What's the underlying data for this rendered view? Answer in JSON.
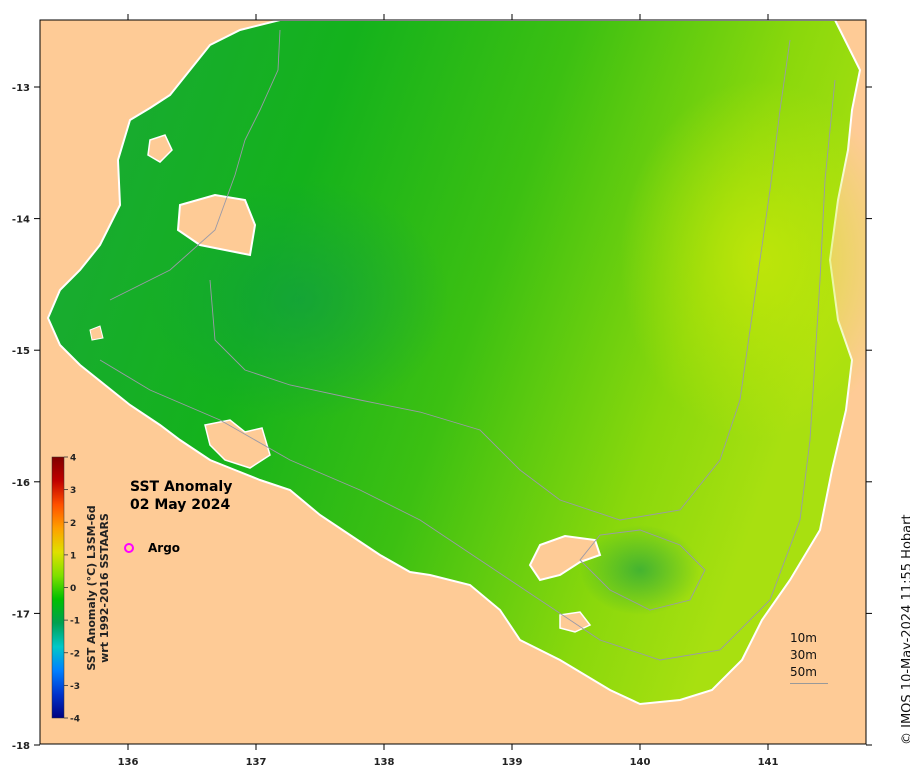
{
  "map": {
    "lon_ticks": [
      "136",
      "137",
      "138",
      "139",
      "140",
      "141"
    ],
    "lat_ticks": [
      "-13",
      "-14",
      "-15",
      "-16",
      "-17",
      "-18"
    ],
    "land_color": "#fecb96",
    "ocean_green": "#1ea81e"
  },
  "title": {
    "line1": "SST Anomaly",
    "line2": "02 May 2024"
  },
  "colorbar": {
    "label_line1": "SST Anomaly (°C) L3SM-6d",
    "label_line2": "wrt 1992-2016 SSTAARS",
    "ticks": [
      "4",
      "3",
      "2",
      "1",
      "0",
      "-1",
      "-2",
      "-3",
      "-4"
    ],
    "colors": [
      "#000080",
      "#0033cc",
      "#0080ff",
      "#00c8c8",
      "#00a050",
      "#00c000",
      "#80e000",
      "#e0e000",
      "#ffa000",
      "#ff5000",
      "#c00000",
      "#800000"
    ]
  },
  "legend": {
    "argo_label": "Argo",
    "argo_color": "#ff00ff"
  },
  "depth_legend": {
    "labels": [
      "10m",
      "30m",
      "50m"
    ]
  },
  "credit": "© IMOS 10-May-2024 11:55 Hobart"
}
